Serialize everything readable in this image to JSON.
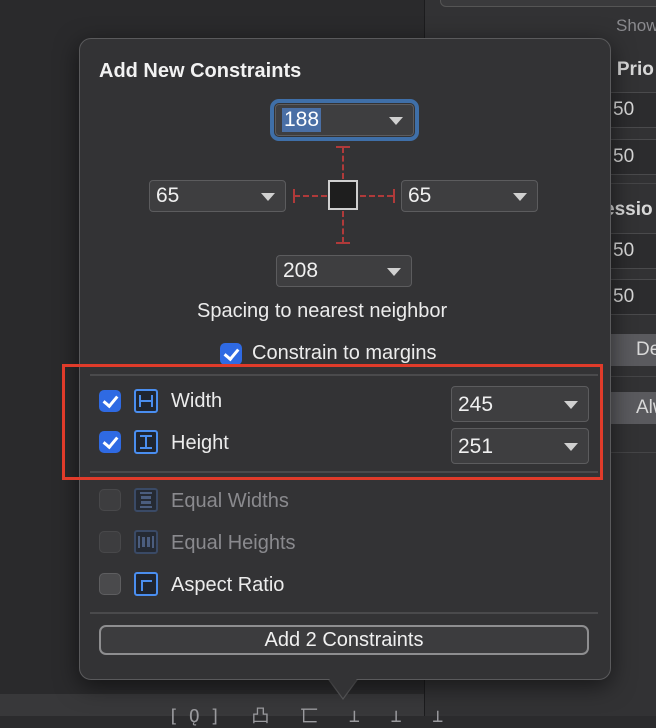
{
  "background": {
    "right_panel": {
      "items": [
        {
          "id": "show",
          "text": "Show"
        },
        {
          "id": "priority",
          "text": "g Prio"
        },
        {
          "id": "val1",
          "text": "50"
        },
        {
          "id": "val2",
          "text": "50"
        },
        {
          "id": "session",
          "text": "essio"
        },
        {
          "id": "val3",
          "text": "50"
        },
        {
          "id": "val4",
          "text": "50"
        },
        {
          "id": "default",
          "text": "Defa"
        },
        {
          "id": "always",
          "text": "Alwa"
        }
      ]
    },
    "bottom_toolbar_icons": "[Ǫ] 凸 匸 ⊥ ⊥ ⊥"
  },
  "popover": {
    "title": "Add New Constraints",
    "spacing": {
      "top": "188",
      "left": "65",
      "right": "65",
      "bottom": "208"
    },
    "spacing_label": "Spacing to nearest neighbor",
    "constrain_to_margins": {
      "label": "Constrain to margins",
      "checked": true
    },
    "constraints": [
      {
        "id": "width",
        "label": "Width",
        "checked": true,
        "value": "245",
        "icon": "width-icon"
      },
      {
        "id": "height",
        "label": "Height",
        "checked": true,
        "value": "251",
        "icon": "height-icon"
      },
      {
        "id": "equal_widths",
        "label": "Equal Widths",
        "checked": false,
        "enabled": false,
        "icon": "equal-widths-icon"
      },
      {
        "id": "equal_heights",
        "label": "Equal Heights",
        "checked": false,
        "enabled": false,
        "icon": "equal-heights-icon"
      },
      {
        "id": "aspect_ratio",
        "label": "Aspect Ratio",
        "checked": false,
        "enabled": true,
        "icon": "aspect-ratio-icon"
      }
    ],
    "add_button": "Add 2 Constraints"
  },
  "colors": {
    "accent_checkbox": "#2f6ae3",
    "icon_blue": "#4a8ef0",
    "annotation_red": "#e03b2a",
    "strut_red": "#b03a3a"
  }
}
